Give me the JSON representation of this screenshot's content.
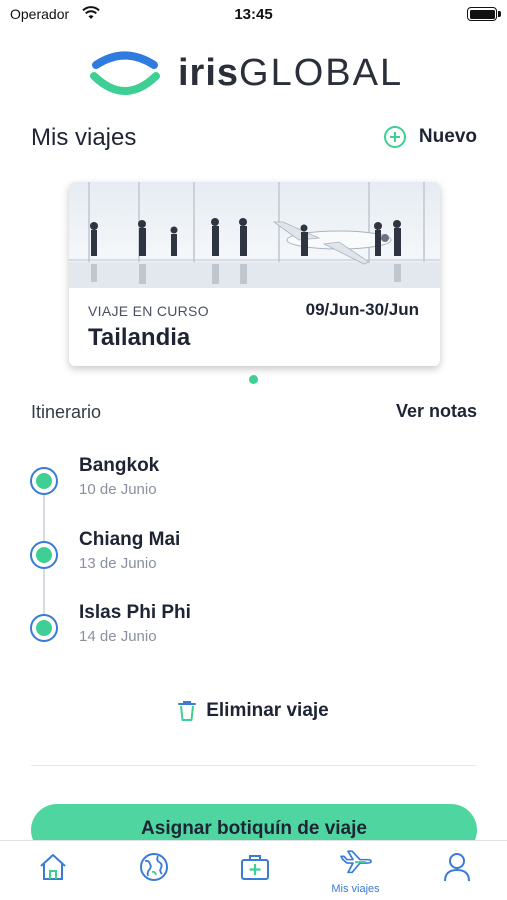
{
  "status_bar": {
    "carrier": "Operador",
    "time": "13:45"
  },
  "brand": {
    "logo_iris": "iris",
    "logo_global": "GLOBAL",
    "colors": {
      "primary_blue": "#3a7bd5",
      "accent_green": "#3fcf95",
      "button_green": "#4fd6a0"
    }
  },
  "header": {
    "title": "Mis viajes",
    "new_label": "Nuevo"
  },
  "trip_card": {
    "status": "VIAJE EN CURSO",
    "dates": "09/Jun-30/Jun",
    "destination": "Tailandia"
  },
  "itinerary": {
    "label": "Itinerario",
    "notes_link": "Ver notas",
    "stops": [
      {
        "name": "Bangkok",
        "date": "10 de Junio"
      },
      {
        "name": "Chiang Mai",
        "date": "13 de Junio"
      },
      {
        "name": "Islas Phi Phi",
        "date": "14 de Junio"
      }
    ]
  },
  "actions": {
    "delete_label": "Eliminar viaje",
    "kit_label": "Asignar botiquín de viaje"
  },
  "tab_bar": {
    "tabs": [
      {
        "icon": "home-icon",
        "label": ""
      },
      {
        "icon": "globe-icon",
        "label": ""
      },
      {
        "icon": "medical-kit-icon",
        "label": ""
      },
      {
        "icon": "airplane-icon",
        "label": "Mis viajes",
        "active": true
      },
      {
        "icon": "profile-icon",
        "label": ""
      }
    ]
  }
}
